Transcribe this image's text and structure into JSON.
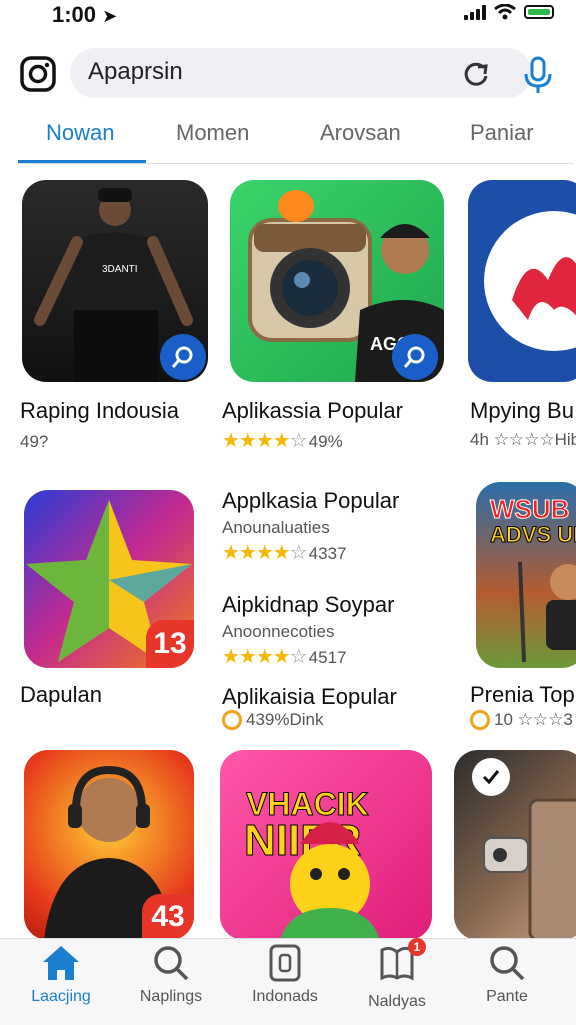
{
  "status": {
    "time": "1:00"
  },
  "search": {
    "value": "Apaprsin"
  },
  "tabs": [
    {
      "label": "Nowan",
      "active": true
    },
    {
      "label": "Momen"
    },
    {
      "label": "Arovsan"
    },
    {
      "label": "Paniar"
    }
  ],
  "row1": [
    {
      "name": "Raping Indousia",
      "meta": "49?"
    },
    {
      "name": "Aplikassia Popular",
      "rating_text": "49%"
    },
    {
      "name": "Mpying Bu",
      "meta": "4h ☆☆☆☆Hib"
    }
  ],
  "row2": {
    "left_name": "Dapulan",
    "left_badge": "13",
    "list": [
      {
        "name": "Applkasia Popular",
        "sub": "Anounaluaties",
        "rating_text": "4337"
      },
      {
        "name": "Aipkidnap Soypar",
        "sub": "Anoonnecoties",
        "rating_text": "4517"
      },
      {
        "name": "Aplikaisia Eopular",
        "sub": "439%Dink"
      }
    ],
    "right_title_top": "WSUB",
    "right_title_bottom": "ADVS UK",
    "right_name": "Prenia Top",
    "right_meta": "10 ☆☆☆3"
  },
  "row3": [
    {
      "badge": "43"
    },
    {
      "title_top": "VHACIK",
      "title_bottom": "NIIER"
    },
    {}
  ],
  "bottom_nav": [
    {
      "label": "Laacjing",
      "icon": "home-icon",
      "active": true
    },
    {
      "label": "Naplings",
      "icon": "search-icon"
    },
    {
      "label": "Indonads",
      "icon": "phone-icon"
    },
    {
      "label": "Naldyas",
      "icon": "book-icon",
      "notification": "1"
    },
    {
      "label": "Pante",
      "icon": "search-icon"
    }
  ],
  "colors": {
    "accent": "#1a7fd0",
    "star": "#f5b800",
    "badge_red": "#e8352a"
  }
}
